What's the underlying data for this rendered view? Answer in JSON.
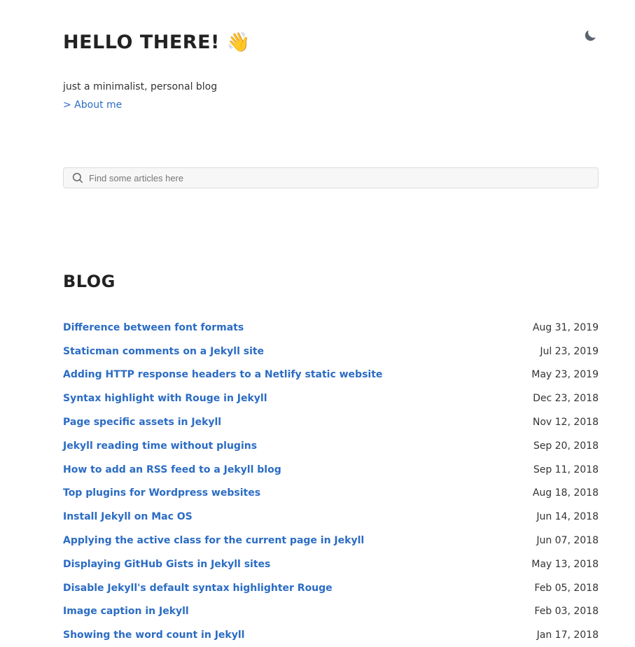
{
  "header": {
    "title": "HELLO THERE! 👋",
    "tagline": "just a minimalist, personal blog",
    "about_link": "> About me",
    "theme_toggle_icon": "moon-icon"
  },
  "search": {
    "placeholder": "Find some articles here",
    "icon": "search-icon"
  },
  "blog": {
    "heading": "BLOG",
    "posts": [
      {
        "title": "Difference between font formats",
        "date": "Aug 31, 2019"
      },
      {
        "title": "Staticman comments on a Jekyll site",
        "date": "Jul 23, 2019"
      },
      {
        "title": "Adding HTTP response headers to a Netlify static website",
        "date": "May 23, 2019"
      },
      {
        "title": "Syntax highlight with Rouge in Jekyll",
        "date": "Dec 23, 2018"
      },
      {
        "title": "Page specific assets in Jekyll",
        "date": "Nov 12, 2018"
      },
      {
        "title": "Jekyll reading time without plugins",
        "date": "Sep 20, 2018"
      },
      {
        "title": "How to add an RSS feed to a Jekyll blog",
        "date": "Sep 11, 2018"
      },
      {
        "title": "Top plugins for Wordpress websites",
        "date": "Aug 18, 2018"
      },
      {
        "title": "Install Jekyll on Mac OS",
        "date": "Jun 14, 2018"
      },
      {
        "title": "Applying the active class for the current page in Jekyll",
        "date": "Jun 07, 2018"
      },
      {
        "title": "Displaying GitHub Gists in Jekyll sites",
        "date": "May 13, 2018"
      },
      {
        "title": "Disable Jekyll's default syntax highlighter Rouge",
        "date": "Feb 05, 2018"
      },
      {
        "title": "Image caption in Jekyll",
        "date": "Feb 03, 2018"
      },
      {
        "title": "Showing the word count in Jekyll",
        "date": "Jan 17, 2018"
      }
    ]
  },
  "colors": {
    "link": "#2b6cc4",
    "text": "#333333",
    "heading": "#222222",
    "search_bg": "#f7f7f7"
  }
}
